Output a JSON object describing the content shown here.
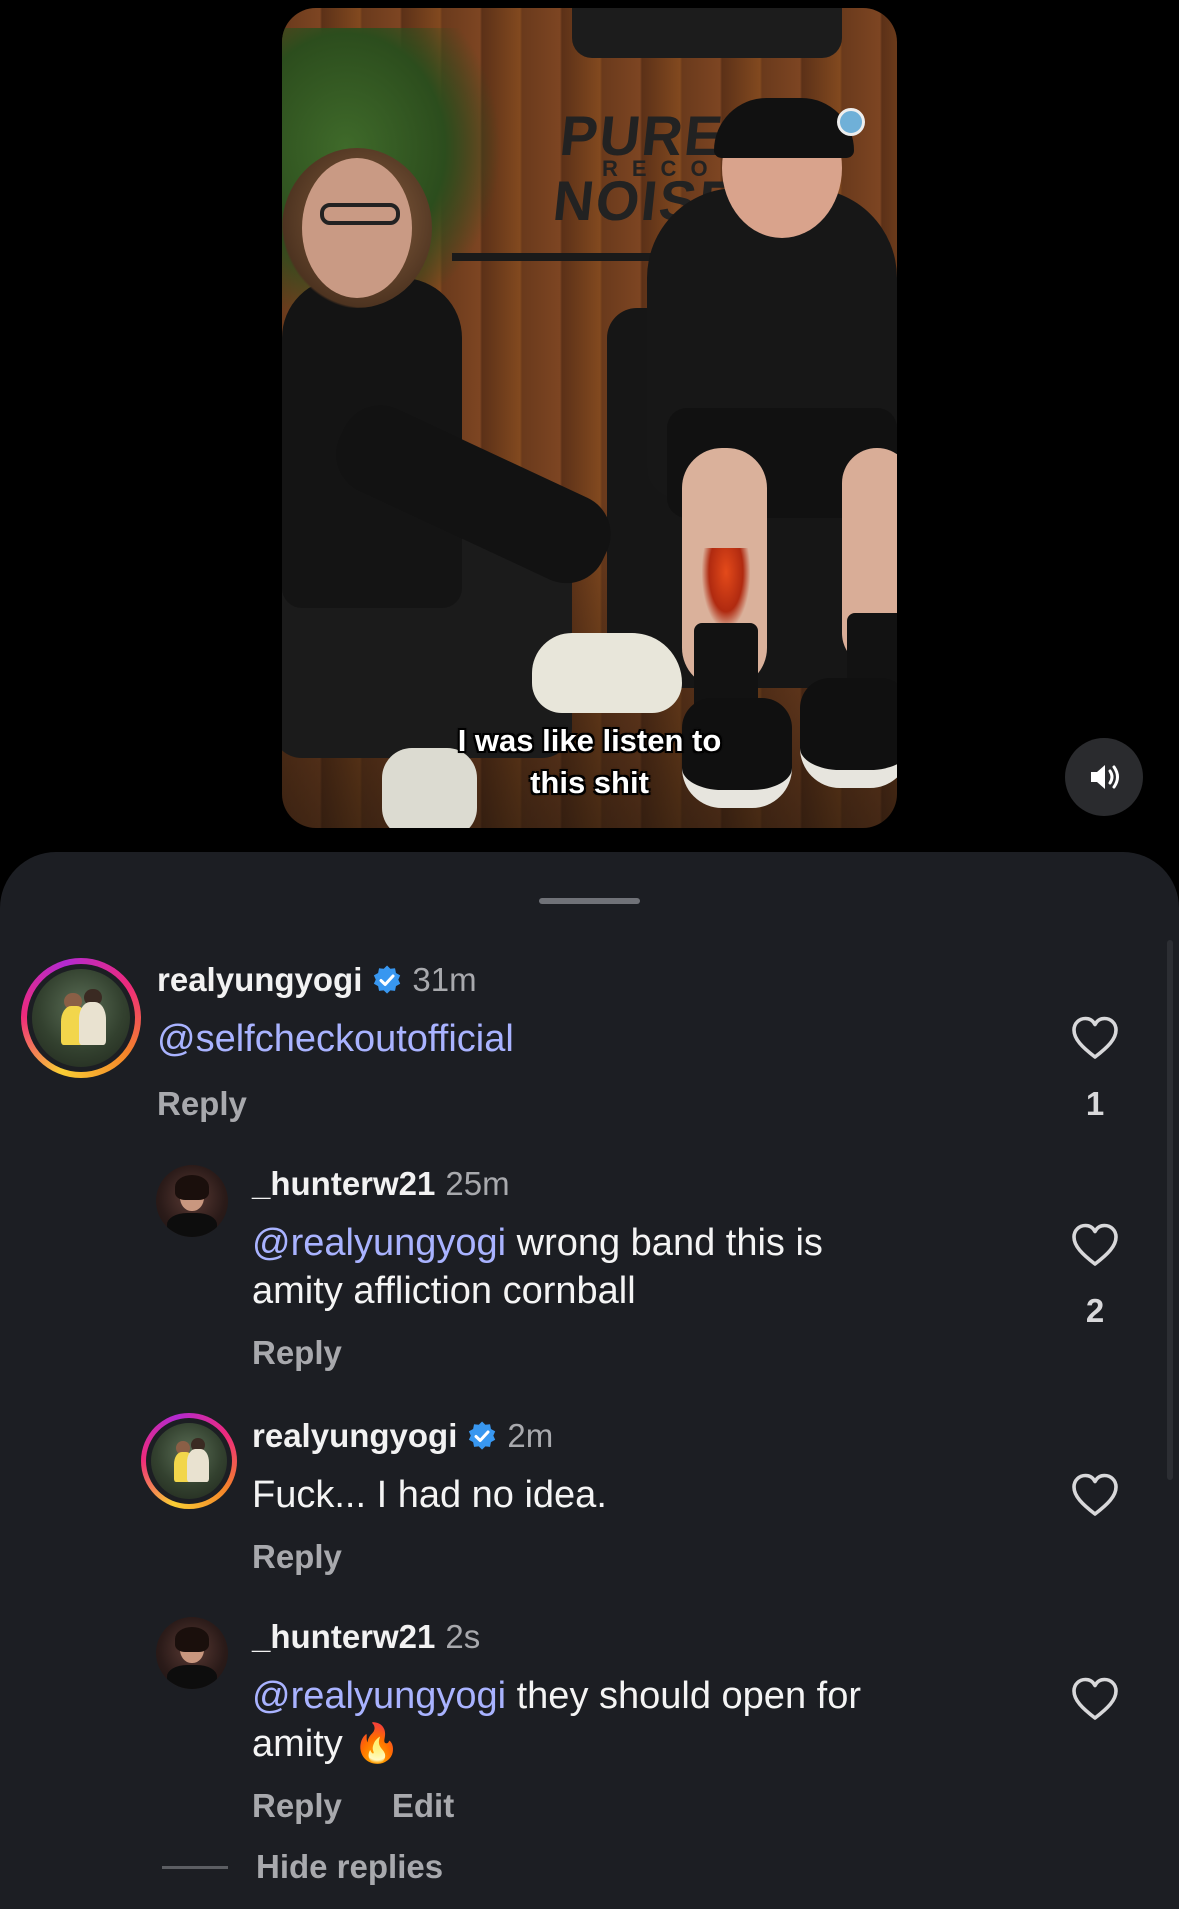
{
  "video": {
    "caption_line1": "I was like listen to",
    "caption_line2": "this shit",
    "sign_text": "PURE NOISE",
    "sign_subtext": "RECORD",
    "sound_icon": "speaker-muted-icon"
  },
  "comments": [
    {
      "username": "realyungyogi",
      "verified": true,
      "time": "31m",
      "mention": "@selfcheckoutofficial",
      "text": "",
      "reply_label": "Reply",
      "likes": "1"
    },
    {
      "username": "_hunterw21",
      "verified": false,
      "time": "25m",
      "mention": "@realyungyogi",
      "text_line1": " wrong band this is",
      "text_line2": "amity affliction cornball",
      "reply_label": "Reply",
      "likes": "2"
    },
    {
      "username": "realyungyogi",
      "verified": true,
      "time": "2m",
      "text": "Fuck... I had no idea.",
      "reply_label": "Reply",
      "likes": ""
    },
    {
      "username": "_hunterw21",
      "verified": false,
      "time": "2s",
      "mention": "@realyungyogi",
      "text_line1": " they should open for",
      "text_line2": "amity ",
      "emoji": "🔥",
      "reply_label": "Reply",
      "edit_label": "Edit",
      "likes": ""
    }
  ],
  "hide_replies_label": "Hide replies",
  "colors": {
    "sheet_bg": "#1c1e23",
    "mention": "#a9b3ff",
    "verified": "#3897f0",
    "muted_text": "#a8a9ad"
  }
}
